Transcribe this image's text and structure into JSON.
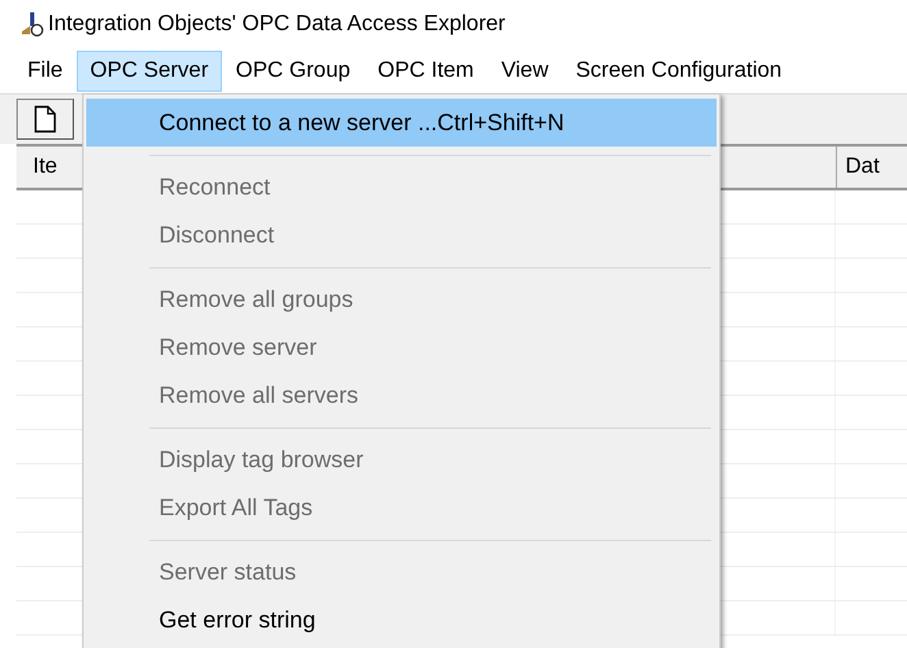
{
  "window": {
    "title": "Integration Objects' OPC Data Access Explorer"
  },
  "menu_bar": [
    {
      "label": "File",
      "selected": false
    },
    {
      "label": "OPC Server",
      "selected": true
    },
    {
      "label": "OPC Group",
      "selected": false
    },
    {
      "label": "OPC Item",
      "selected": false
    },
    {
      "label": "View",
      "selected": false
    },
    {
      "label": "Screen Configuration",
      "selected": false
    }
  ],
  "table": {
    "columns": [
      "Ite",
      "Dat"
    ]
  },
  "dropdown_menu": {
    "groups": [
      [
        {
          "label": "Connect to a new server ...Ctrl+Shift+N",
          "disabled": false,
          "selected": true
        }
      ],
      [
        {
          "label": "Reconnect",
          "disabled": true,
          "selected": false
        },
        {
          "label": "Disconnect",
          "disabled": true,
          "selected": false
        }
      ],
      [
        {
          "label": "Remove all groups",
          "disabled": true,
          "selected": false
        },
        {
          "label": "Remove server",
          "disabled": true,
          "selected": false
        },
        {
          "label": "Remove all servers",
          "disabled": true,
          "selected": false
        }
      ],
      [
        {
          "label": "Display tag browser",
          "disabled": true,
          "selected": false
        },
        {
          "label": "Export All Tags",
          "disabled": true,
          "selected": false
        }
      ],
      [
        {
          "label": "Server status",
          "disabled": true,
          "selected": false
        },
        {
          "label": "Get error string",
          "disabled": false,
          "selected": false
        }
      ]
    ]
  }
}
